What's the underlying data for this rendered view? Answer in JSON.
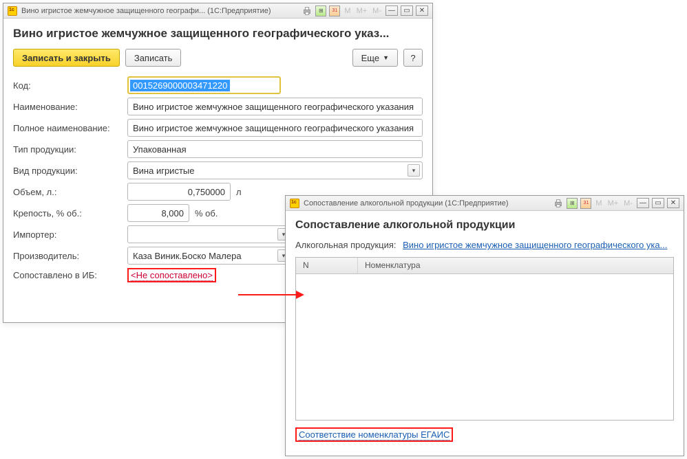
{
  "win1": {
    "titlebar": "Вино игристое жемчужное защищенного географи...  (1С:Предприятие)",
    "page_title": "Вино игристое жемчужное защищенного географического указ...",
    "toolbar": {
      "write_close": "Записать и закрыть",
      "write": "Записать",
      "more": "Еще",
      "help": "?"
    },
    "labels": {
      "code": "Код:",
      "name": "Наименование:",
      "full_name": "Полное наименование:",
      "product_type": "Тип продукции:",
      "product_kind": "Вид продукции:",
      "volume": "Объем, л.:",
      "strength": "Крепость, % об.:",
      "importer": "Импортер:",
      "producer": "Производитель:",
      "matched": "Сопоставлено в ИБ:"
    },
    "values": {
      "code": "0015269000003471220",
      "name": "Вино игристое жемчужное защищенного географического указания",
      "full_name": "Вино игристое жемчужное защищенного географического указания",
      "product_type": "Упакованная",
      "product_kind": "Вина игристые",
      "volume": "0,750000",
      "volume_unit": "л",
      "strength": "8,000",
      "strength_unit": "% об.",
      "importer": "",
      "producer": "Каза Виник.Боско Малера",
      "matched_link": "<Не сопоставлено>"
    }
  },
  "win2": {
    "titlebar": "Сопоставление алкогольной продукции  (1С:Предприятие)",
    "page_title": "Сопоставление алкогольной продукции",
    "field_label": "Алкогольная продукция:",
    "field_link": "Вино игристое жемчужное защищенного географического ука...",
    "table": {
      "col_n": "N",
      "col_item": "Номенклатура"
    },
    "footer_link": "Соответствие номенклатуры ЕГАИС"
  },
  "mem": {
    "m": "M",
    "mplus": "M+",
    "mminus": "M-"
  }
}
